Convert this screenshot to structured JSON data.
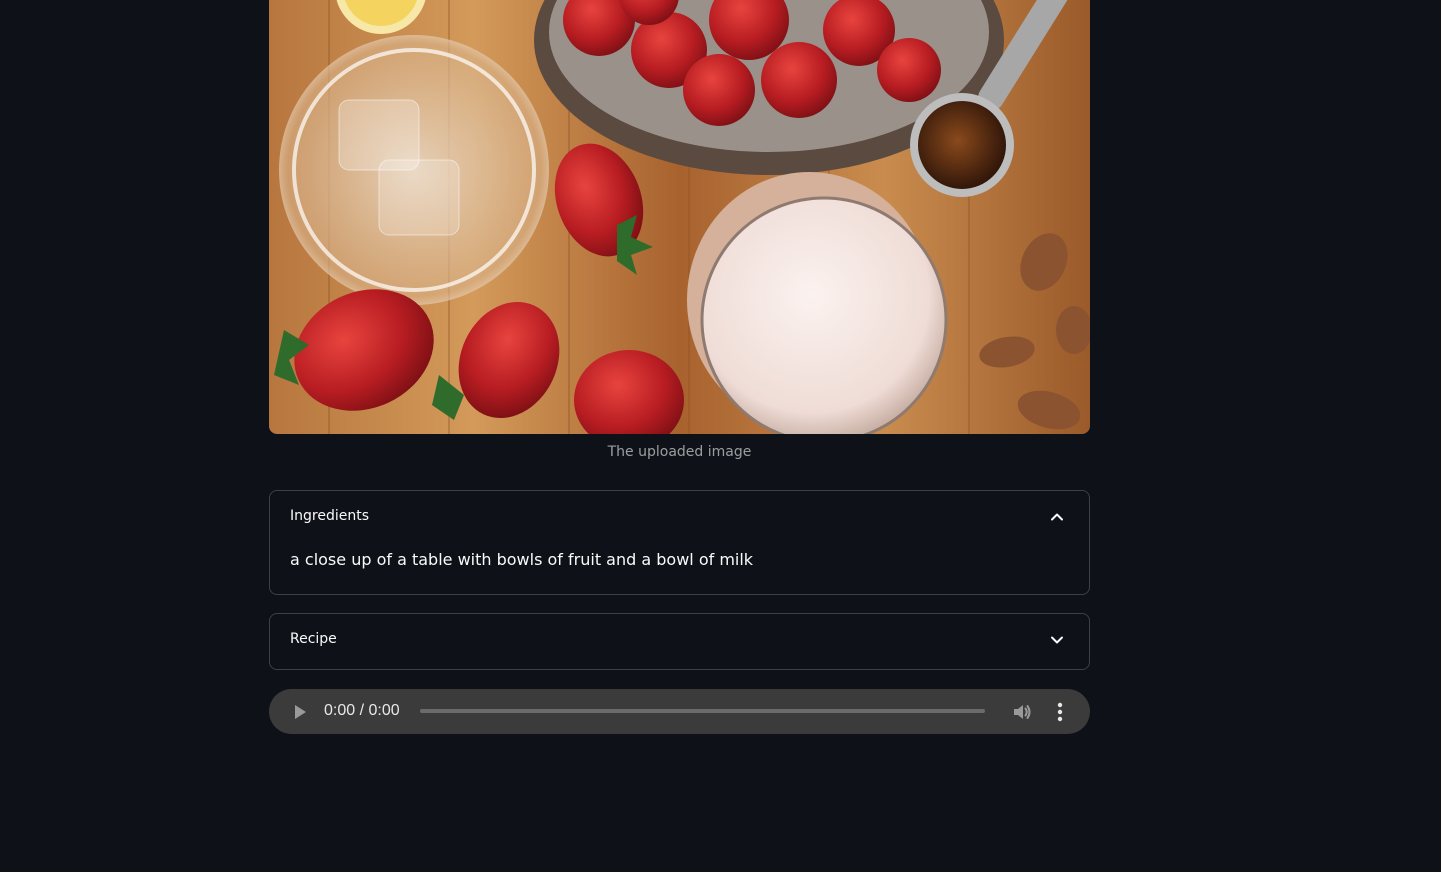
{
  "image": {
    "caption": "The uploaded image"
  },
  "expanders": [
    {
      "title": "Ingredients",
      "expanded": true,
      "icon": "chevron-up-icon",
      "content": "a close up of a table with bowls of fruit and a bowl of milk"
    },
    {
      "title": "Recipe",
      "expanded": false,
      "icon": "chevron-down-icon",
      "content": ""
    }
  ],
  "audio": {
    "time_display": "0:00 / 0:00",
    "progress": 0,
    "icons": [
      "play-icon",
      "volume-icon",
      "more-options-icon"
    ]
  },
  "colors": {
    "background": "#0e1117",
    "border": "rgba(250,250,250,0.2)",
    "audio_bar": "#3b3b3b"
  }
}
